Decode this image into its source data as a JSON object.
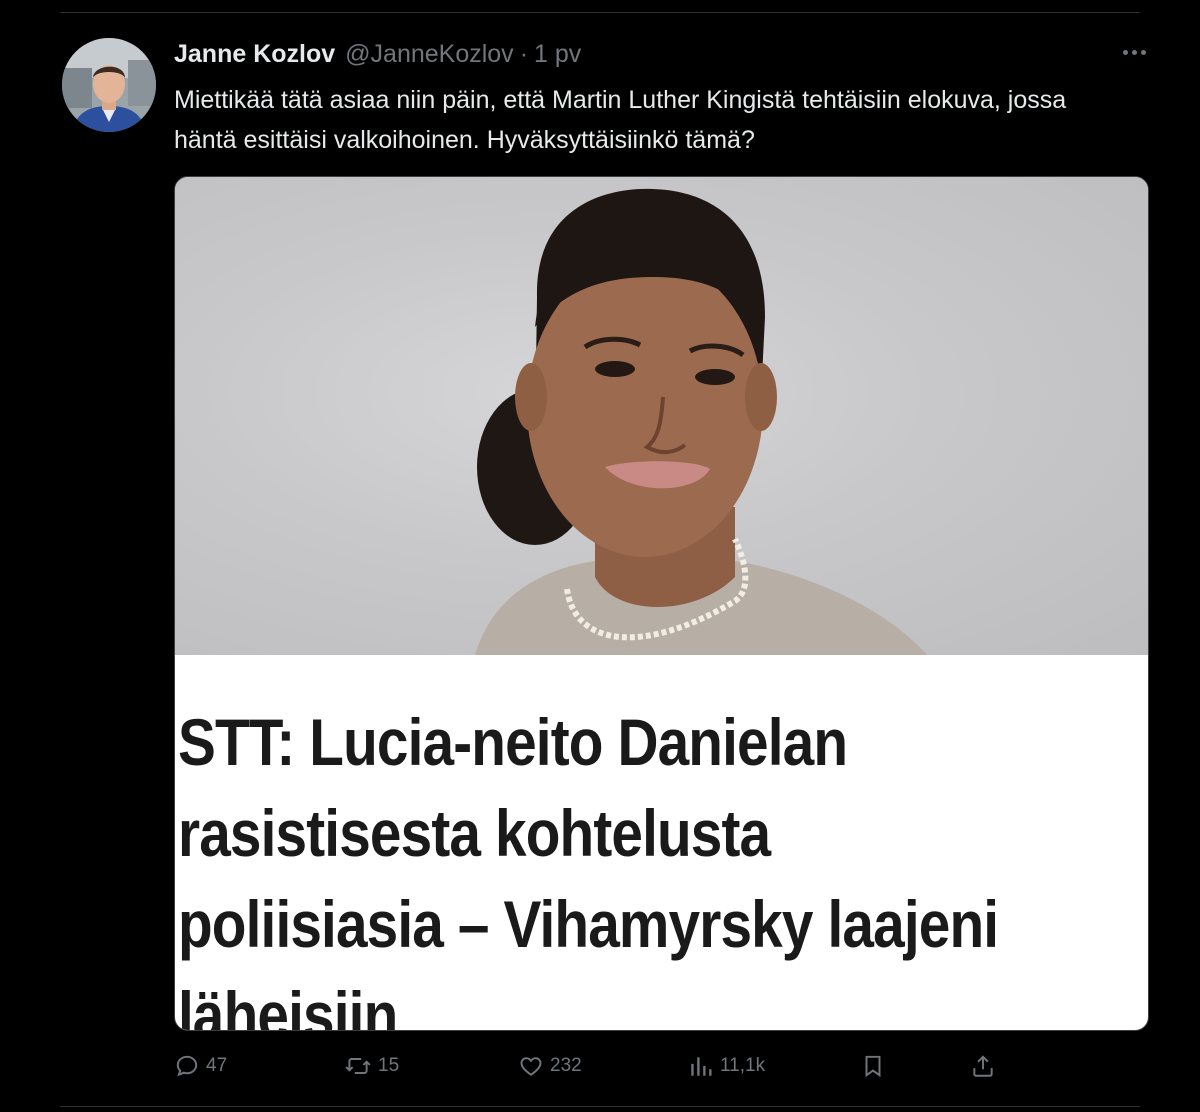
{
  "tweet": {
    "author_name": "Janne Kozlov",
    "author_handle": "@JanneKozlov",
    "separator": "·",
    "time": "1 pv",
    "text": "Miettikää tätä asiaa niin päin, että Martin Luther Kingistä tehtäisiin elokuva, jossa häntä esittäisi valkoihoinen. Hyväksyttäisiinkö tämä?",
    "more_icon": "more-dots-icon"
  },
  "media": {
    "headline_lines": [
      "STT: Lucia-neito Danielan",
      "rasistisesta kohtelusta",
      "poliisiasia – Vihamyrsky laajeni",
      "läheisiin"
    ],
    "headline_color": "#1a1a1a",
    "background_color": "#ffffff"
  },
  "actions": {
    "replies": {
      "icon": "reply-icon",
      "count": "47"
    },
    "reposts": {
      "icon": "repost-icon",
      "count": "15"
    },
    "likes": {
      "icon": "heart-icon",
      "count": "232"
    },
    "views": {
      "icon": "views-chart-icon",
      "count": "11,1k"
    },
    "bookmark": {
      "icon": "bookmark-icon"
    },
    "share": {
      "icon": "share-upload-icon"
    }
  },
  "colors": {
    "background": "#000000",
    "text_primary": "#e7e9ea",
    "text_secondary": "#71767b",
    "divider": "#2f3336"
  }
}
